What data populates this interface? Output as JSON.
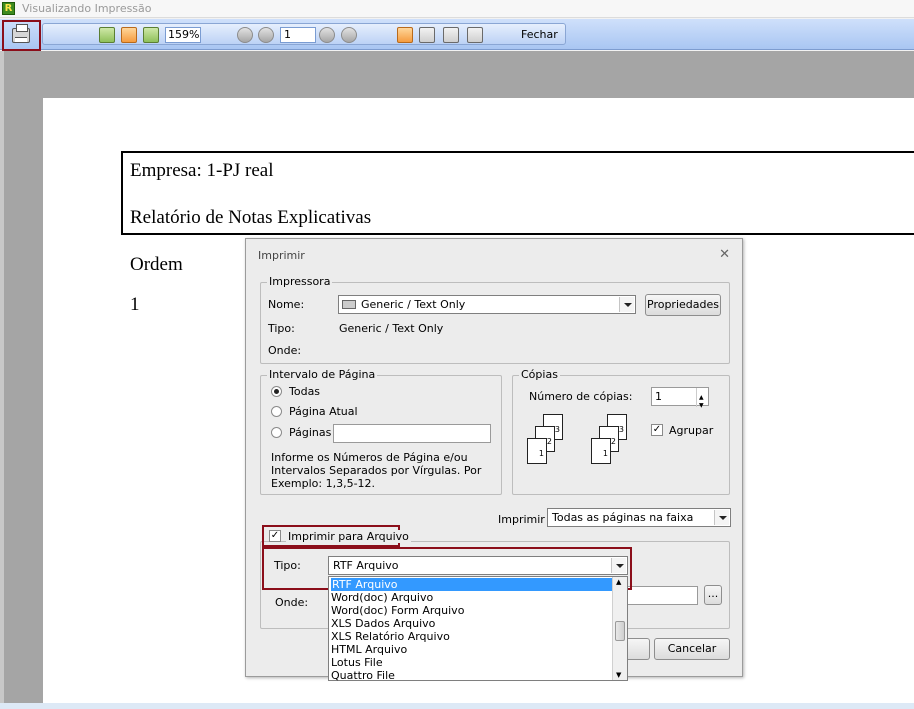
{
  "window": {
    "title": "Visualizando Impressão",
    "logo_letter": "R"
  },
  "toolbar": {
    "zoom": "159%",
    "page": "1",
    "close_label": "Fechar"
  },
  "report": {
    "company": "Empresa: 1-PJ real",
    "report_title": "Relatório de Notas Explicativas",
    "column_header": "Ordem",
    "row_value": "1"
  },
  "dialog": {
    "title": "Imprimir",
    "close_glyph": "✕",
    "printer": {
      "legend": "Impressora",
      "name_label": "Nome:",
      "name_value": "Generic / Text Only",
      "properties_button": "Propriedades",
      "type_label": "Tipo:",
      "type_value": "Generic / Text Only",
      "where_label": "Onde:"
    },
    "page_range": {
      "legend": "Intervalo de Página",
      "all": "Todas",
      "current": "Página Atual",
      "pages": "Páginas",
      "hint_line1": "Informe os Números de Página e/ou",
      "hint_line2": "Intervalos Separados por Vírgulas. Por",
      "hint_line3": "Exemplo: 1,3,5-12."
    },
    "copies": {
      "legend": "Cópias",
      "count_label": "Número de cópias:",
      "count_value": "1",
      "collate_label": "Agrupar",
      "page_labels": [
        "1",
        "2",
        "3"
      ]
    },
    "print_what": {
      "label": "Imprimir",
      "value": "Todas as páginas na faixa"
    },
    "print_to_file": {
      "label": "Imprimir para Arquivo",
      "type_label": "Tipo:",
      "type_value": "RTF Arquivo",
      "where_label": "Onde:",
      "browse": "...",
      "options": [
        "RTF Arquivo",
        "Word(doc) Arquivo",
        "Word(doc) Form Arquivo",
        "XLS Dados Arquivo",
        "XLS Relatório Arquivo",
        "HTML Arquivo",
        "Lotus File",
        "Quattro File"
      ]
    },
    "cancel_button": "Cancelar"
  }
}
